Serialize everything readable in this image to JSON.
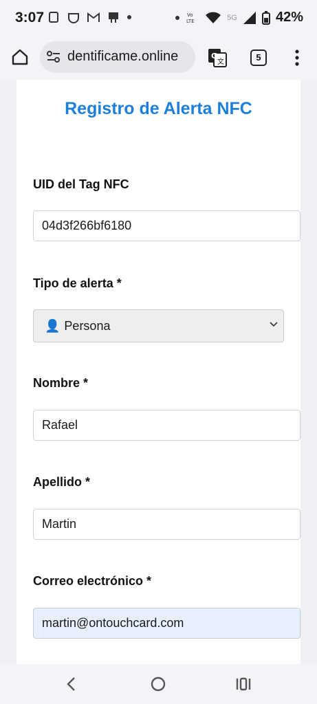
{
  "status_bar": {
    "time": "3:07",
    "battery_percent": "42%",
    "network_label": "5G"
  },
  "browser": {
    "url": "dentificame.online",
    "tab_count": "5"
  },
  "form": {
    "title": "Registro de Alerta NFC",
    "fields": {
      "uid_label": "UID del Tag NFC",
      "uid_value": "04d3f266bf6180",
      "tipo_label": "Tipo de alerta *",
      "tipo_emoji": "👤",
      "tipo_value": "Persona",
      "nombre_label": "Nombre *",
      "nombre_value": "Rafael",
      "apellido_label": "Apellido *",
      "apellido_value": "Martin",
      "correo_label": "Correo electrónico *",
      "correo_value": "martin@ontouchcard.com"
    }
  },
  "colors": {
    "title": "#1e7fd8",
    "autofill_bg": "#e8f0fe"
  }
}
